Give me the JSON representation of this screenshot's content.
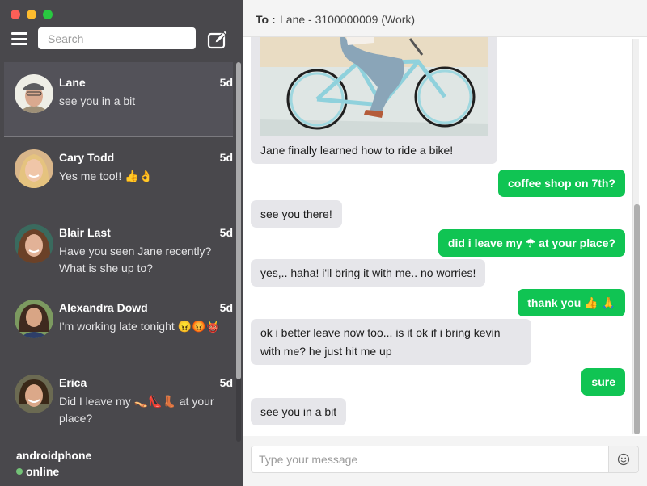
{
  "window": {
    "controls": [
      "close",
      "minimize",
      "zoom"
    ]
  },
  "sidebar": {
    "menu_icon": "hamburger-icon",
    "search_placeholder": "Search",
    "compose_icon": "compose-icon",
    "conversations": [
      {
        "name": "Lane",
        "time": "5d",
        "preview": "see you in a bit",
        "active": true,
        "avatar": "lane-avatar"
      },
      {
        "name": "Cary Todd",
        "time": "5d",
        "preview": "Yes me too!! 👍👌",
        "active": false,
        "avatar": "cary-todd-avatar"
      },
      {
        "name": "Blair Last",
        "time": "5d",
        "preview": "Have you seen Jane recently? What is she up to?",
        "active": false,
        "avatar": "blair-last-avatar"
      },
      {
        "name": "Alexandra Dowd",
        "time": "5d",
        "preview": "I'm working late tonight 😠😡👹",
        "active": false,
        "avatar": "alexandra-dowd-avatar"
      },
      {
        "name": "Erica",
        "time": "5d",
        "preview": "Did I leave my 👡👠👢 at your place?",
        "active": false,
        "avatar": "erica-avatar"
      }
    ],
    "status": {
      "device": "androidphone",
      "state": "online",
      "state_color": "#73c277"
    }
  },
  "chat": {
    "to_label": "To :",
    "to_value": "Lane - 3100000009 (Work)",
    "messages": [
      {
        "direction": "in",
        "type": "image",
        "image": "girl-riding-bike-photo",
        "text": "Jane finally learned how to ride a bike!"
      },
      {
        "direction": "out",
        "text": "coffee shop on 7th?"
      },
      {
        "direction": "in",
        "text": "see you there!"
      },
      {
        "direction": "out",
        "text": "did i leave my ☂ at your place?"
      },
      {
        "direction": "in",
        "text": "yes,.. haha! i'll bring it with me.. no worries!"
      },
      {
        "direction": "out",
        "text": "thank you 👍 🙏"
      },
      {
        "direction": "in",
        "text": "ok i better leave now too... is it ok if i bring kevin with me? he just hit me up"
      },
      {
        "direction": "out",
        "text": "sure"
      },
      {
        "direction": "in",
        "text": "see you in a bit"
      }
    ],
    "composer": {
      "placeholder": "Type your message",
      "value": "",
      "emoji_icon": "smiley-icon"
    }
  },
  "colors": {
    "sidebar_bg": "#49484c",
    "active_conversation_bg": "#535259",
    "outgoing_bubble": "#10c453",
    "incoming_bubble": "#e6e6ea"
  }
}
